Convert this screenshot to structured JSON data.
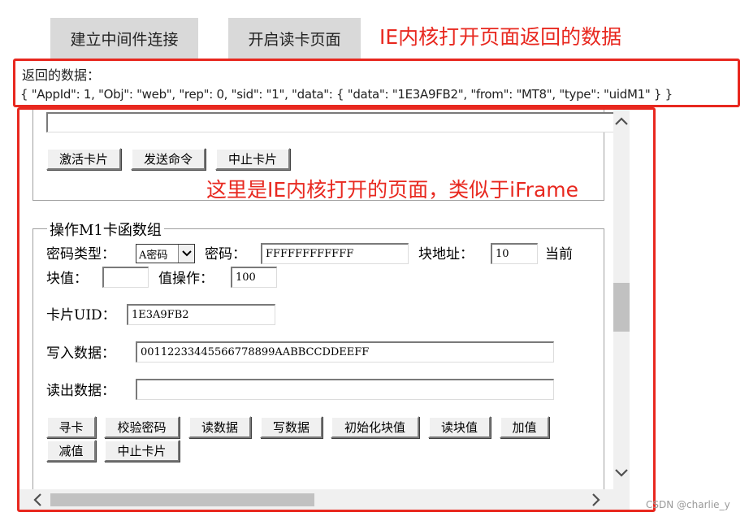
{
  "top_buttons": {
    "connect": "建立中间件连接",
    "open_read_page": "开启读卡页面"
  },
  "annotations": {
    "top_note": "IE内核打开页面返回的数据",
    "iframe_note": "这里是IE内核打开的页面，类似于iFrame"
  },
  "return_data": {
    "label": "返回的数据：",
    "json": "{ \"AppId\": 1, \"Obj\": \"web\", \"rep\": 0, \"sid\": \"1\", \"data\": { \"data\": \"1E3A9FB2\", \"from\": \"MT8\", \"type\": \"uidM1\" } }"
  },
  "card_ops": {
    "activate": "激活卡片",
    "send_cmd": "发送命令",
    "stop": "中止卡片"
  },
  "m1_group": {
    "legend": "操作M1卡函数组",
    "key_type_label": "密码类型：",
    "key_type_value": "A密码",
    "password_label": "密码：",
    "password_value": "FFFFFFFFFFFF",
    "block_addr_label": "块地址：",
    "block_addr_value": "10",
    "current_label": "当前",
    "block_value_label": "块值：",
    "block_value_value": "",
    "value_op_label": "值操作：",
    "value_op_value": "100",
    "uid_label": "卡片UID：",
    "uid_value": "1E3A9FB2",
    "write_label": "写入数据：",
    "write_value": "00112233445566778899AABBCCDDEEFF",
    "read_label": "读出数据：",
    "read_value": "",
    "buttons": [
      "寻卡",
      "校验密码",
      "读数据",
      "写数据",
      "初始化块值",
      "读块值",
      "加值",
      "减值",
      "中止卡片"
    ]
  },
  "watermark": "CSDN @charlie_y",
  "icons": [
    "chevron-up-icon",
    "chevron-down-icon",
    "chevron-left-icon",
    "chevron-right-icon",
    "select-dropdown-icon"
  ]
}
